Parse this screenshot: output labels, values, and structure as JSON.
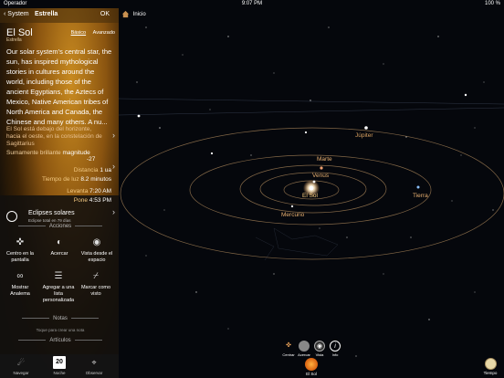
{
  "status": {
    "carrier": "Operador",
    "time": "9:07 PM",
    "battery": "100 %"
  },
  "panel": {
    "back_label": "System",
    "nav_title": "Estrella",
    "ok_label": "OK",
    "object_name": "El Sol",
    "object_type": "Estrella",
    "tabs": [
      "Básico",
      "Avanzado"
    ],
    "description": "Our solar system's central star, the sun, has inspired mythological stories in cultures around the world, including those of the ancient Egyptians, the Aztecs of Mexico, Native American tribes of North America and Canada, the Chinese and many others. A nu...",
    "below_horizon": "El Sol está debajo del horizonte, hacia el oeste, en la constelación de Sagittarius",
    "magnitude": {
      "label": "Sumamente brillante",
      "key": "magnitude",
      "value": "-27"
    },
    "distance": {
      "label": "Distancia",
      "value": "1 ua"
    },
    "daylight": {
      "label": "Tiempo de luz",
      "value": "8.2 minutos"
    },
    "rise": {
      "label": "Levanta",
      "value": "7:20 AM"
    },
    "set": {
      "label": "Pone",
      "value": "4:53 PM"
    },
    "eclipse": {
      "title": "Eclipses solares",
      "subtitle": "Eclipse total en 79 días"
    },
    "actions_header": "Acciones",
    "actions": [
      {
        "label": "Centro en la pantalla",
        "icon": "target-icon"
      },
      {
        "label": "Acercar",
        "icon": "zoom-planet-icon"
      },
      {
        "label": "Vista desde el espacio",
        "icon": "3d-view-icon"
      },
      {
        "label": "Mostrar Analema",
        "icon": "analemma-icon"
      },
      {
        "label": "Agregar a una lista personalizada",
        "icon": "list-add-icon"
      },
      {
        "label": "Marcar como visto",
        "icon": "telescope-icon"
      }
    ],
    "notes_header": "Notas",
    "notes_hint": "Toque para crear una nota",
    "articles_header": "Artículos"
  },
  "tabbar": [
    {
      "label": "Navegar",
      "icon": "navigate-icon"
    },
    {
      "label": "Noche",
      "icon": "calendar-icon",
      "day": "20"
    },
    {
      "label": "Observar",
      "icon": "observe-icon"
    }
  ],
  "sky": {
    "home_label": "Inicio",
    "labels": {
      "jupiter": "Júpiter",
      "marte": "Marte",
      "venus": "Venus",
      "sol": "El Sol",
      "mercurio": "Mercurio",
      "tierra": "Tierra"
    },
    "tools": [
      {
        "label": "Centrar",
        "icon": "center-icon"
      },
      {
        "label": "Acercar",
        "icon": "zoom-icon"
      },
      {
        "label": "Vista",
        "icon": "view-icon"
      },
      {
        "label": "Info",
        "icon": "info-icon"
      }
    ],
    "sun_button": "El Sol",
    "time_button": "Tiempo"
  },
  "colors": {
    "accent": "#f2c880",
    "orbit": "#b89060",
    "label": "#e8b070"
  }
}
